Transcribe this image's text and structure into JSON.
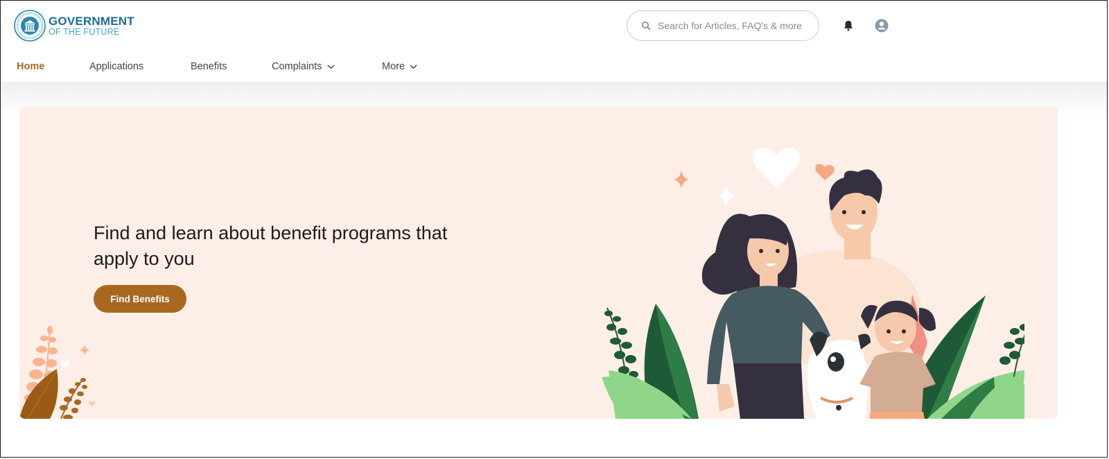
{
  "brand": {
    "line1": "GOVERNMENT",
    "line2": "OF THE FUTURE",
    "primary_color": "#1a6f93",
    "secondary_color": "#3ea3cf"
  },
  "search": {
    "placeholder": "Search for Articles, FAQ's & more",
    "value": "",
    "icon": "search-icon"
  },
  "header_icons": {
    "notifications": "bell-icon",
    "profile": "user-avatar-icon"
  },
  "nav": {
    "items": [
      {
        "label": "Home",
        "active": true,
        "has_dropdown": false
      },
      {
        "label": "Applications",
        "active": false,
        "has_dropdown": false
      },
      {
        "label": "Benefits",
        "active": false,
        "has_dropdown": false
      },
      {
        "label": "Complaints",
        "active": false,
        "has_dropdown": true
      },
      {
        "label": "More",
        "active": false,
        "has_dropdown": true
      }
    ],
    "active_color": "#a86820"
  },
  "hero": {
    "title": "Find and learn about benefit programs that apply to you",
    "button_label": "Find Benefits",
    "button_color": "#a86820",
    "background_color": "#fdeee7",
    "illustration": "family-with-dog-illustration"
  }
}
